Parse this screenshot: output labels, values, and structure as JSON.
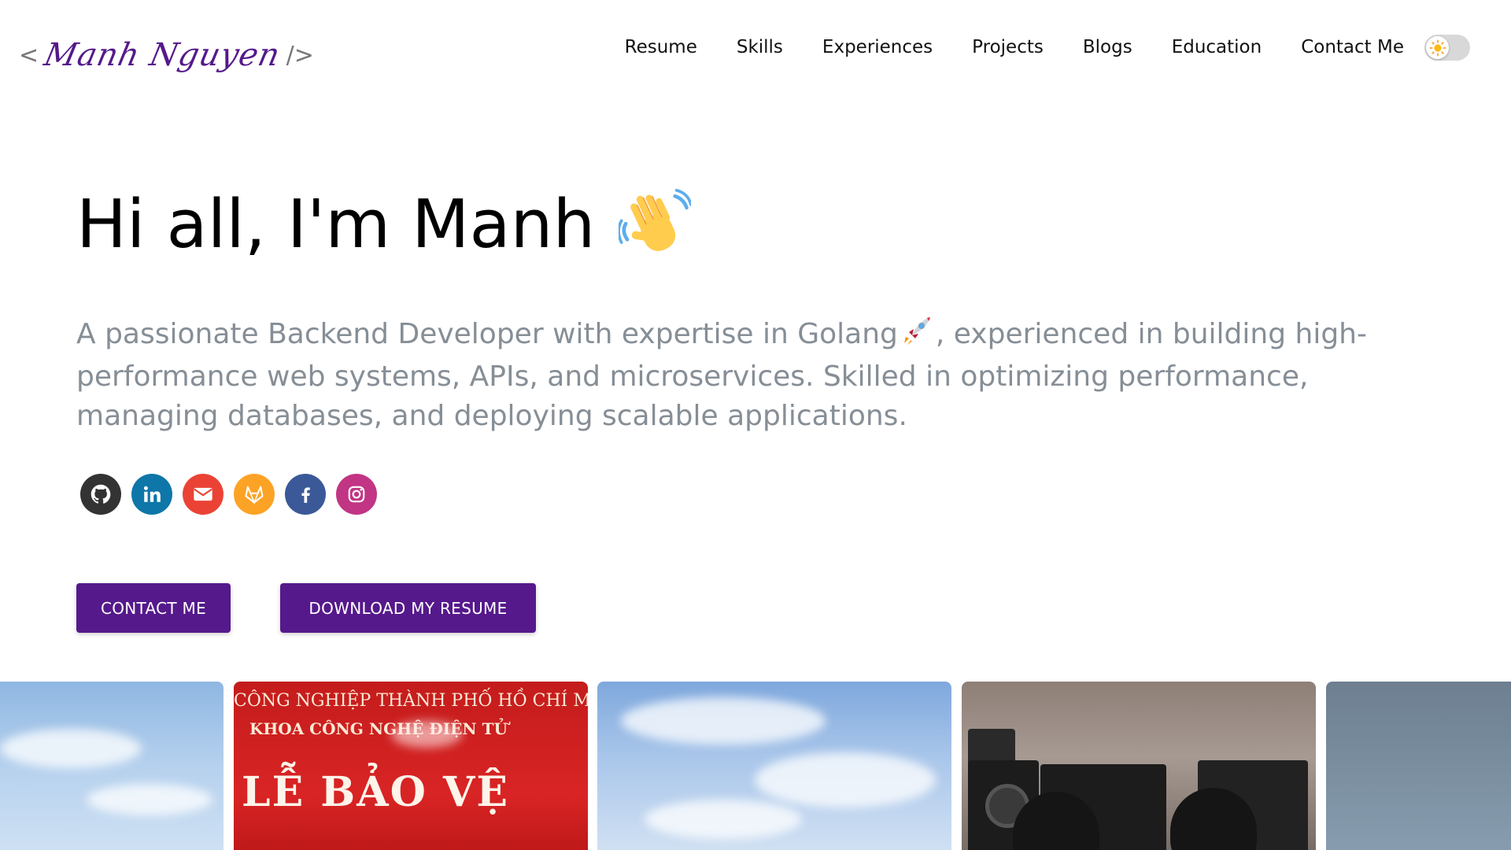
{
  "logo": {
    "open_bracket": "<",
    "signature": "Manh Nguyen",
    "close_bracket": "/>"
  },
  "nav": {
    "items": [
      "Resume",
      "Skills",
      "Experiences",
      "Projects",
      "Blogs",
      "Education",
      "Contact Me"
    ]
  },
  "theme_toggle": {
    "mode": "light",
    "icon": "sun-icon"
  },
  "hero": {
    "greeting": "Hi all, I'm Manh",
    "greeting_emoji": "waving-hand-icon",
    "subtitle_part1": "A passionate Backend Developer with expertise in Golang",
    "subtitle_emoji": "rocket-icon",
    "subtitle_part2": ", experienced in building high-performance web systems, APIs, and microservices. Skilled in optimizing performance, managing databases, and deploying scalable applications."
  },
  "socials": [
    {
      "name": "github",
      "color": "#333333"
    },
    {
      "name": "linkedin",
      "color": "#0e76a8"
    },
    {
      "name": "email",
      "color": "#ea4335"
    },
    {
      "name": "gitlab",
      "color": "#fca326"
    },
    {
      "name": "facebook",
      "color": "#3b5998"
    },
    {
      "name": "instagram",
      "color": "#c13584"
    }
  ],
  "buttons": {
    "contact": "CONTACT ME",
    "resume": "DOWNLOAD MY RESUME"
  },
  "photos": {
    "banner_line1": "CÔNG NGHIỆP THÀNH PHỐ HỒ CHÍ MINH",
    "banner_line2": "KHOA CÔNG NGHỆ ĐIỆN TỬ",
    "banner_line3": "LỄ BẢO VỆ"
  },
  "colors": {
    "accent": "#55198b",
    "subtitle": "#868e96"
  }
}
